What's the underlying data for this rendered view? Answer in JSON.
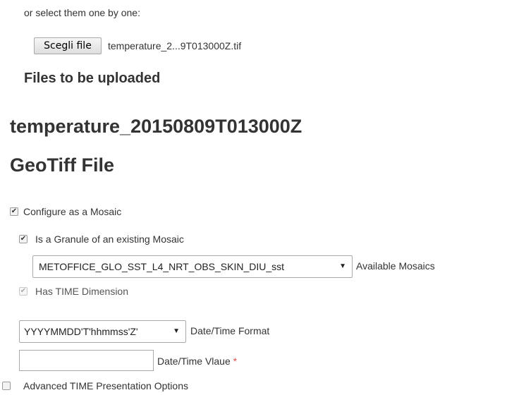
{
  "upload": {
    "hint": "or select them one by one:",
    "choose_file_label": "Scegli file",
    "selected_file": "temperature_2...9T013000Z.tif",
    "files_heading": "Files to be uploaded"
  },
  "file": {
    "title": "temperature_20150809T013000Z",
    "type_heading": "GeoTiff File"
  },
  "options": {
    "configure_mosaic": {
      "label": "Configure as a Mosaic",
      "checked": true
    },
    "is_granule": {
      "label": "Is a Granule of an existing Mosaic",
      "checked": true
    },
    "mosaic_select": {
      "value": "METOFFICE_GLO_SST_L4_NRT_OBS_SKIN_DIU_sst",
      "label": "Available Mosaics"
    },
    "has_time": {
      "label": "Has TIME Dimension",
      "checked": true,
      "disabled": true
    },
    "time_format_select": {
      "value": "YYYYMMDD'T'hhmmss'Z'",
      "label": "Date/Time Format"
    },
    "time_value": {
      "label": "Date/Time Vlaue",
      "required_mark": "*",
      "value": ""
    },
    "advanced_time": {
      "label": "Advanced TIME Presentation Options",
      "checked": false
    }
  },
  "icons": {
    "check": "✔",
    "dropdown": "▼"
  }
}
